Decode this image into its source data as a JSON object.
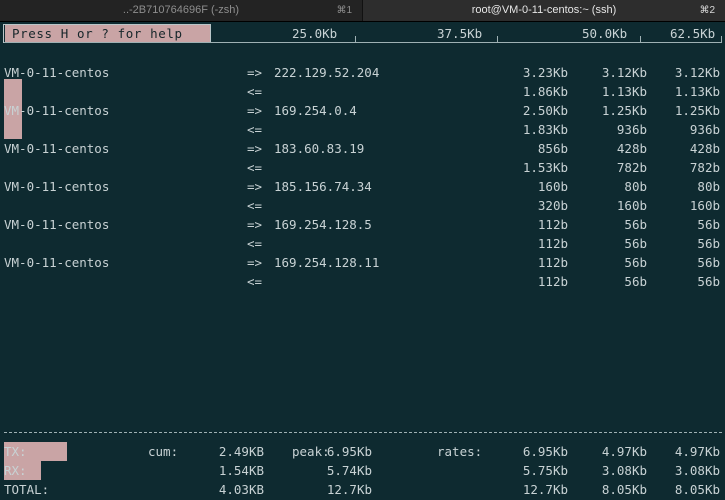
{
  "tabs": [
    {
      "label": "..-2B710764696F (-zsh)",
      "shortcut": "⌘1",
      "active": false
    },
    {
      "label": "root@VM-0-11-centos:~ (ssh)",
      "shortcut": "⌘2",
      "active": true
    }
  ],
  "help_text": "Press H or ? for help",
  "scale": [
    "25.0Kb",
    "37.5Kb",
    "50.0Kb",
    "62.5Kb"
  ],
  "flows": [
    {
      "host": "VM-0-11-centos",
      "out_dir": "=>",
      "in_dir": "<=",
      "remote": "222.129.52.204",
      "out": [
        "3.23Kb",
        "3.12Kb",
        "3.12Kb"
      ],
      "in": [
        "1.86Kb",
        "1.13Kb",
        "1.13Kb"
      ]
    },
    {
      "host": "VM-0-11-centos",
      "out_dir": "=>",
      "in_dir": "<=",
      "remote": "169.254.0.4",
      "out": [
        "2.50Kb",
        "1.25Kb",
        "1.25Kb"
      ],
      "in": [
        "1.83Kb",
        "936b",
        "936b"
      ]
    },
    {
      "host": "VM-0-11-centos",
      "out_dir": "=>",
      "in_dir": "<=",
      "remote": "183.60.83.19",
      "out": [
        "856b",
        "428b",
        "428b"
      ],
      "in": [
        "1.53Kb",
        "782b",
        "782b"
      ]
    },
    {
      "host": "VM-0-11-centos",
      "out_dir": "=>",
      "in_dir": "<=",
      "remote": "185.156.74.34",
      "out": [
        "160b",
        "80b",
        "80b"
      ],
      "in": [
        "320b",
        "160b",
        "160b"
      ]
    },
    {
      "host": "VM-0-11-centos",
      "out_dir": "=>",
      "in_dir": "<=",
      "remote": "169.254.128.5",
      "out": [
        "112b",
        "56b",
        "56b"
      ],
      "in": [
        "112b",
        "56b",
        "56b"
      ]
    },
    {
      "host": "VM-0-11-centos",
      "out_dir": "=>",
      "in_dir": "<=",
      "remote": "169.254.128.11",
      "out": [
        "112b",
        "56b",
        "56b"
      ],
      "in": [
        "112b",
        "56b",
        "56b"
      ]
    }
  ],
  "totals": {
    "labels": {
      "cum": "cum:",
      "peak": "peak:",
      "rates": "rates:"
    },
    "rows": [
      {
        "label": "TX:",
        "cum": "2.49KB",
        "peak": "6.95Kb",
        "rates": [
          "6.95Kb",
          "4.97Kb",
          "4.97Kb"
        ]
      },
      {
        "label": "RX:",
        "cum": "1.54KB",
        "peak": "5.74Kb",
        "rates": [
          "5.75Kb",
          "3.08Kb",
          "3.08Kb"
        ]
      },
      {
        "label": "TOTAL:",
        "cum": "4.03KB",
        "peak": "12.7Kb",
        "rates": [
          "12.7Kb",
          "8.05Kb",
          "8.05Kb"
        ]
      }
    ]
  },
  "colors": {
    "background": "#0e2a30",
    "foreground": "#c8d2d4",
    "highlight": "#c9a4a5"
  }
}
